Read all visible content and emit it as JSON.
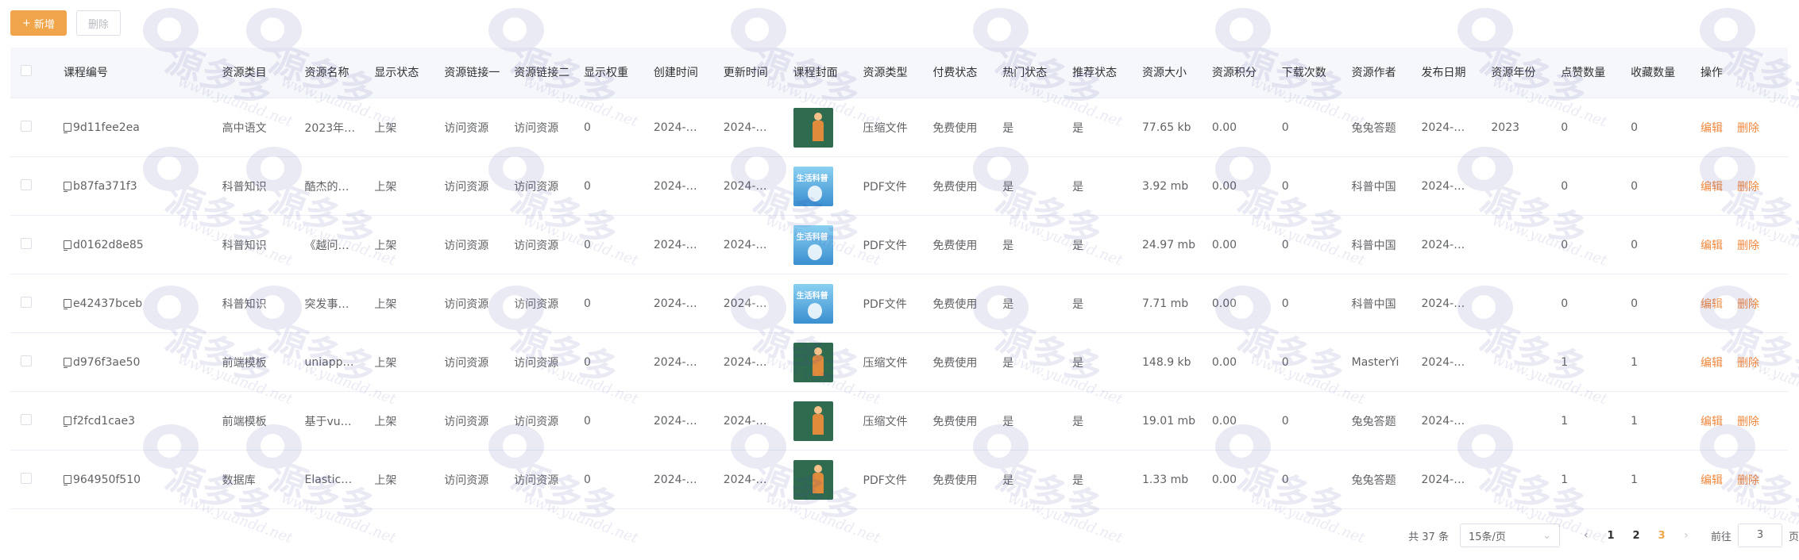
{
  "toolbar": {
    "add_label": "新增",
    "delete_label": "删除"
  },
  "table": {
    "headers": [
      "课程编号",
      "资源类目",
      "资源名称",
      "显示状态",
      "资源链接一",
      "资源链接二",
      "显示权重",
      "创建时间",
      "更新时间",
      "课程封面",
      "资源类型",
      "付费状态",
      "热门状态",
      "推荐状态",
      "资源大小",
      "资源积分",
      "下载次数",
      "资源作者",
      "发布日期",
      "资源年份",
      "点赞数量",
      "收藏数量",
      "操作"
    ],
    "rows": [
      {
        "code": "9d11fee2ea",
        "cat": "高中语文",
        "name": "2023年…",
        "show": "上架",
        "l1": "访问资源",
        "l2": "访问资源",
        "w": "0",
        "c": "2024-…",
        "u": "2024-…",
        "cover": "green",
        "type": "压缩文件",
        "pay": "免费使用",
        "hot": "是",
        "rec": "是",
        "size": "77.65 kb",
        "pt": "0.00",
        "dl": "0",
        "auth": "兔兔答题",
        "date": "2024-…",
        "year": "2023",
        "like": "0",
        "fav": "0"
      },
      {
        "code": "b87fa371f3",
        "cat": "科普知识",
        "name": "酷杰的…",
        "show": "上架",
        "l1": "访问资源",
        "l2": "访问资源",
        "w": "0",
        "c": "2024-…",
        "u": "2024-…",
        "cover": "blue",
        "type": "PDF文件",
        "pay": "免费使用",
        "hot": "是",
        "rec": "是",
        "size": "3.92 mb",
        "pt": "0.00",
        "dl": "0",
        "auth": "科普中国",
        "date": "2024-…",
        "year": "",
        "like": "0",
        "fav": "0"
      },
      {
        "code": "d0162d8e85",
        "cat": "科普知识",
        "name": "《越问…",
        "show": "上架",
        "l1": "访问资源",
        "l2": "访问资源",
        "w": "0",
        "c": "2024-…",
        "u": "2024-…",
        "cover": "blue",
        "type": "PDF文件",
        "pay": "免费使用",
        "hot": "是",
        "rec": "是",
        "size": "24.97 mb",
        "pt": "0.00",
        "dl": "0",
        "auth": "科普中国",
        "date": "2024-…",
        "year": "",
        "like": "0",
        "fav": "0"
      },
      {
        "code": "e42437bceb",
        "cat": "科普知识",
        "name": "突发事…",
        "show": "上架",
        "l1": "访问资源",
        "l2": "访问资源",
        "w": "0",
        "c": "2024-…",
        "u": "2024-…",
        "cover": "blue",
        "type": "PDF文件",
        "pay": "免费使用",
        "hot": "是",
        "rec": "是",
        "size": "7.71 mb",
        "pt": "0.00",
        "dl": "0",
        "auth": "科普中国",
        "date": "2024-…",
        "year": "",
        "like": "0",
        "fav": "0"
      },
      {
        "code": "d976f3ae50",
        "cat": "前端模板",
        "name": "uniapp…",
        "show": "上架",
        "l1": "访问资源",
        "l2": "访问资源",
        "w": "0",
        "c": "2024-…",
        "u": "2024-…",
        "cover": "green",
        "type": "压缩文件",
        "pay": "免费使用",
        "hot": "是",
        "rec": "是",
        "size": "148.9 kb",
        "pt": "0.00",
        "dl": "0",
        "auth": "MasterYi",
        "date": "2024-…",
        "year": "",
        "like": "1",
        "fav": "1"
      },
      {
        "code": "f2fcd1cae3",
        "cat": "前端模板",
        "name": "基于vu…",
        "show": "上架",
        "l1": "访问资源",
        "l2": "访问资源",
        "w": "0",
        "c": "2024-…",
        "u": "2024-…",
        "cover": "green",
        "type": "压缩文件",
        "pay": "免费使用",
        "hot": "是",
        "rec": "是",
        "size": "19.01 mb",
        "pt": "0.00",
        "dl": "0",
        "auth": "兔兔答题",
        "date": "2024-…",
        "year": "",
        "like": "1",
        "fav": "1"
      },
      {
        "code": "964950f510",
        "cat": "数据库",
        "name": "Elastic…",
        "show": "上架",
        "l1": "访问资源",
        "l2": "访问资源",
        "w": "0",
        "c": "2024-…",
        "u": "2024-…",
        "cover": "green",
        "type": "PDF文件",
        "pay": "免费使用",
        "hot": "是",
        "rec": "是",
        "size": "1.33 mb",
        "pt": "0.00",
        "dl": "0",
        "auth": "兔兔答题",
        "date": "2024-…",
        "year": "",
        "like": "1",
        "fav": "1"
      }
    ],
    "ops": {
      "edit": "编辑",
      "delete": "删除"
    }
  },
  "pagination": {
    "total_text": "共 37 条",
    "page_size": "15条/页",
    "pages": [
      "1",
      "2",
      "3"
    ],
    "current_page": "3",
    "goto_label": "前往",
    "goto_value": "3",
    "page_suffix": "页"
  },
  "watermark": {
    "text": "源多多",
    "url": "www.yuandd.net"
  },
  "colors": {
    "accent": "#f0a54a",
    "link": "#f0883e"
  }
}
